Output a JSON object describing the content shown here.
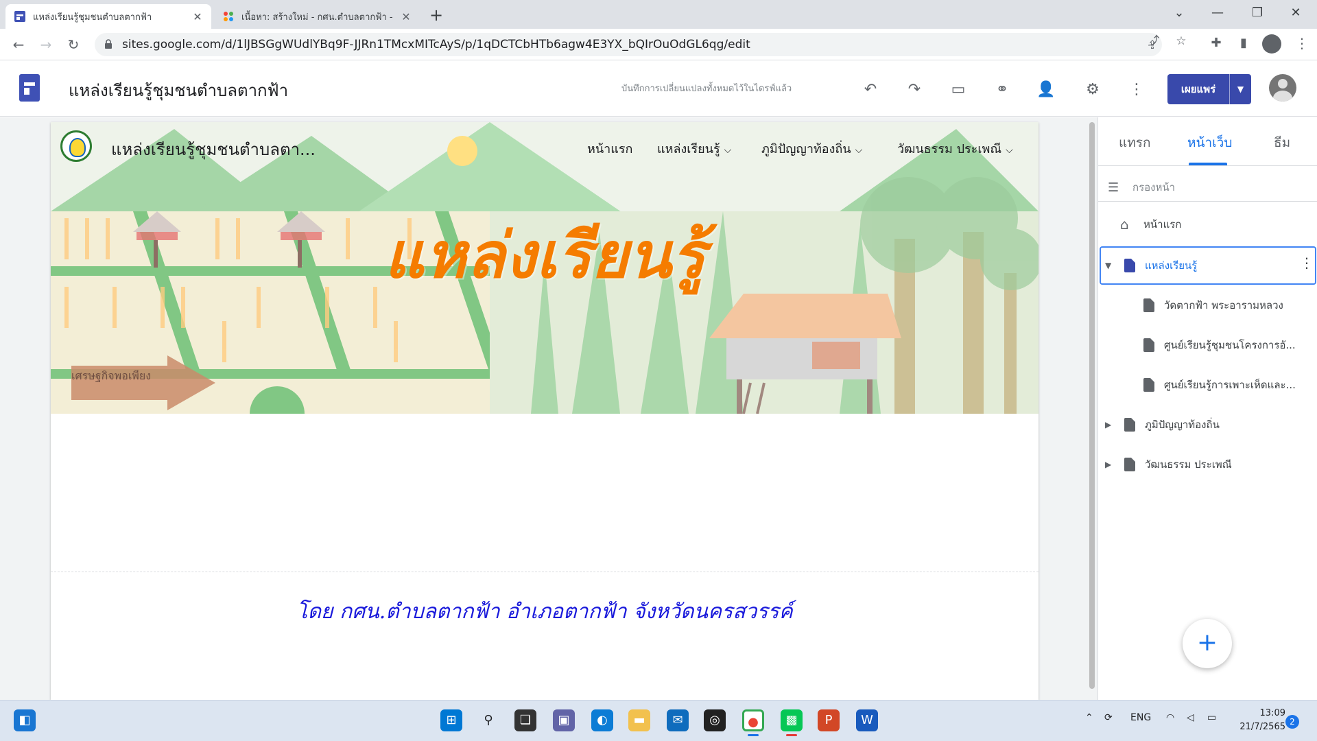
{
  "browser": {
    "tabs": [
      {
        "title": "แหล่งเรียนรู้ชุมชนตำบลตากฟ้า",
        "active": true
      },
      {
        "title": "เนื้อหา: สร้างใหม่ - กศน.ตำบลตากฟ้า -",
        "active": false
      }
    ],
    "url": "sites.google.com/d/1lJBSGgWUdlYBq9F-JJRn1TMcxMITcAyS/p/1qDCTCbHTb6agw4E3YX_bQIrOuOdGL6qg/edit"
  },
  "editor": {
    "site_title": "แหล่งเรียนรู้ชุมชนตำบลตากฟ้า",
    "save_status": "บันทึกการเปลี่ยนแปลงทั้งหมดไว้ในไดรฟ์แล้ว",
    "publish_label": "เผยแพร่"
  },
  "site": {
    "name": "แหล่งเรียนรู้ชุมชนตำบลตา...",
    "nav": {
      "home": "หน้าแรก",
      "learning": "แหล่งเรียนรู้",
      "wisdom": "ภูมิปัญญาท้องถิ่น",
      "culture": "วัฒนธรรม ประเพณี"
    },
    "hero_title": "แหล่งเรียนรู้",
    "signpost": "เศรษฐกิจพอเพียง",
    "footer": "โดย กศน.ตำบลตากฟ้า อำเภอตากฟ้า จังหวัดนครสวรรค์"
  },
  "panel": {
    "tabs": {
      "insert": "แทรก",
      "pages": "หน้าเว็บ",
      "themes": "ธีม"
    },
    "filter_placeholder": "กรองหน้า",
    "pages": {
      "home": "หน้าแรก",
      "learning": "แหล่งเรียนรู้",
      "sub1": "วัดตากฟ้า พระอารามหลวง",
      "sub2": "ศูนย์เรียนรู้ชุมชนโครงการอั...",
      "sub3": "ศูนย์เรียนรู้การเพาะเห็ดและ...",
      "wisdom": "ภูมิปัญญาท้องถิ่น",
      "culture": "วัฒนธรรม ประเพณี"
    }
  },
  "taskbar": {
    "lang": "ENG",
    "time": "13:09",
    "date": "21/7/2565",
    "notifications": "2"
  }
}
